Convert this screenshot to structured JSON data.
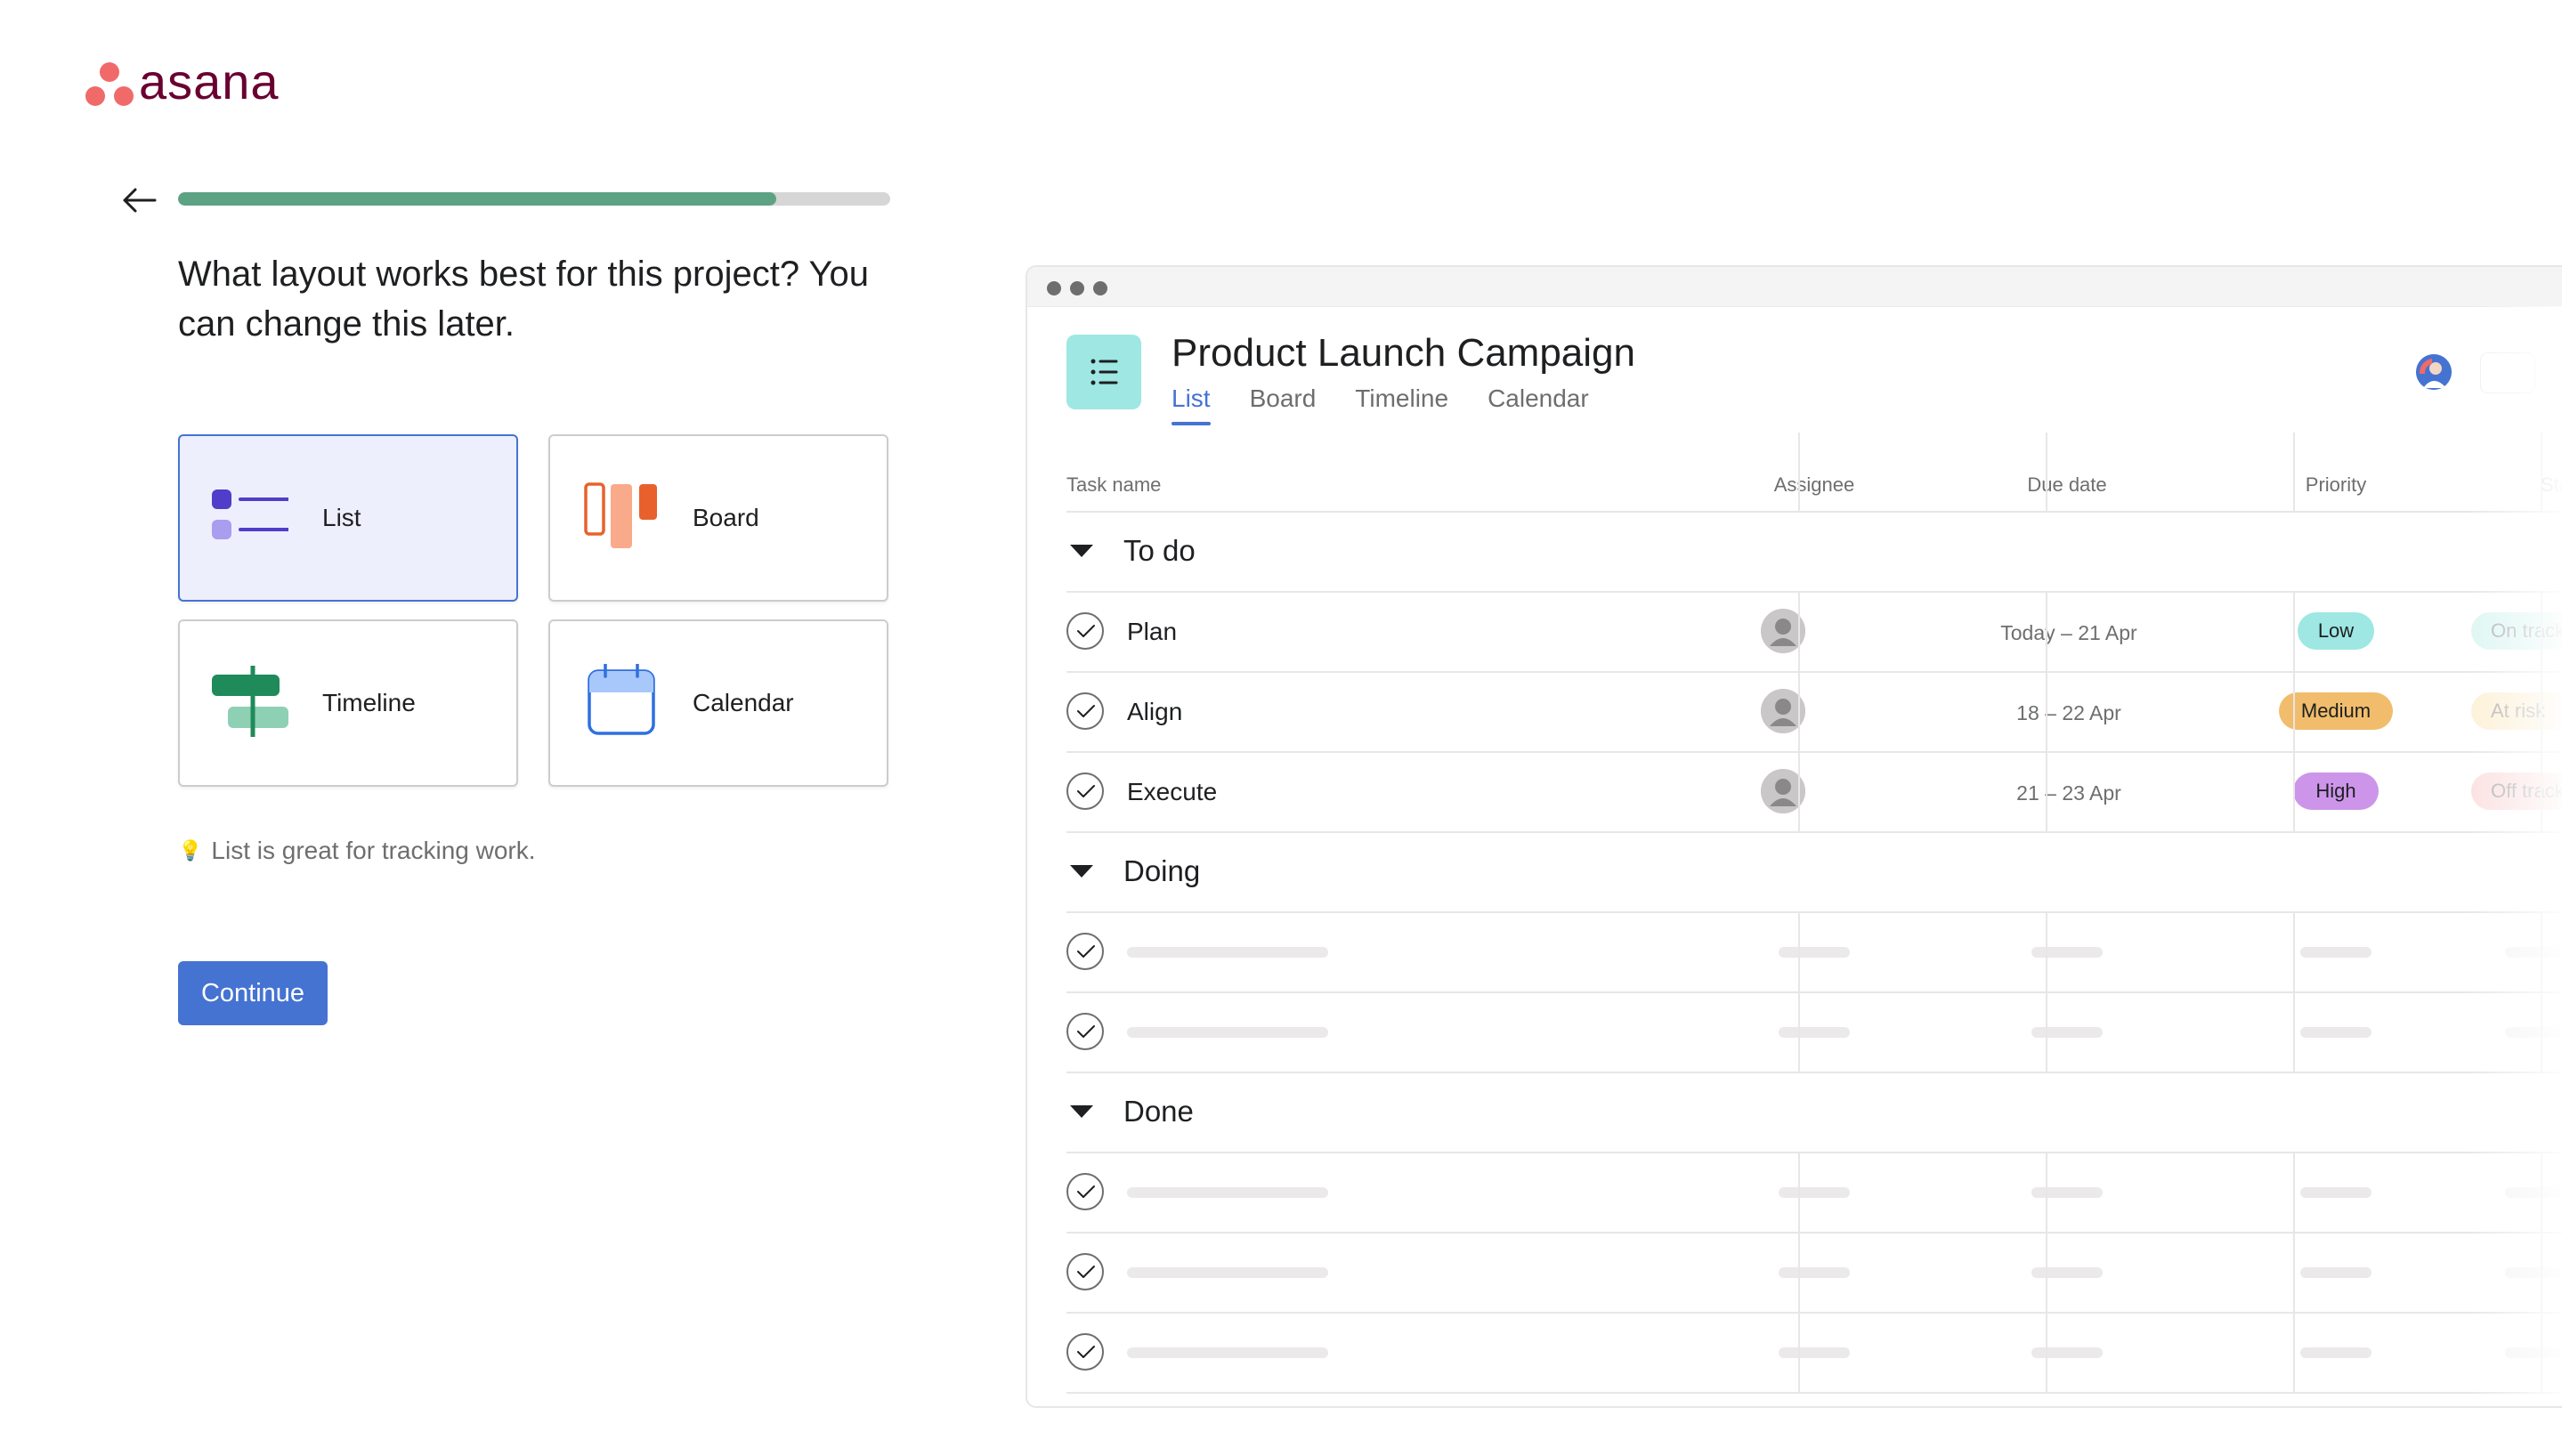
{
  "brand": {
    "name": "asana",
    "logo_color": "#f06a6a",
    "wordmark_color": "#690031"
  },
  "onboarding": {
    "back_icon": "arrow-left-icon",
    "progress": 0.84,
    "question": "What layout works best for this project? You can change this later.",
    "layouts": [
      {
        "label": "List",
        "icon": "list-layout-icon",
        "selected": true
      },
      {
        "label": "Board",
        "icon": "board-layout-icon",
        "selected": false
      },
      {
        "label": "Timeline",
        "icon": "timeline-layout-icon",
        "selected": false
      },
      {
        "label": "Calendar",
        "icon": "calendar-layout-icon",
        "selected": false
      }
    ],
    "tip_icon": "lightbulb-icon",
    "tip": "List is great for tracking work.",
    "continue_label": "Continue"
  },
  "preview": {
    "project_title": "Product Launch Campaign",
    "tabs": [
      "List",
      "Board",
      "Timeline",
      "Calendar"
    ],
    "active_tab": "List",
    "columns": [
      "Task name",
      "Assignee",
      "Due date",
      "Priority",
      "Status"
    ],
    "sections": [
      {
        "name": "To do",
        "tasks": [
          {
            "name": "Plan",
            "due": "Today – 21 Apr",
            "priority": "Low",
            "status": "On track"
          },
          {
            "name": "Align",
            "due": "18 – 22 Apr",
            "priority": "Medium",
            "status": "At risk"
          },
          {
            "name": "Execute",
            "due": "21 – 23 Apr",
            "priority": "High",
            "status": "Off track"
          }
        ]
      },
      {
        "name": "Doing",
        "placeholder_rows": 2
      },
      {
        "name": "Done",
        "placeholder_rows": 3
      }
    ],
    "colors": {
      "accent": "#4573d2",
      "low": "#9ee7e3",
      "medium": "#f1bd6c",
      "high": "#cd95ea",
      "on_track": "#c2efe9",
      "at_risk": "#fbe6b8",
      "off_track": "#f9c9c9"
    }
  }
}
